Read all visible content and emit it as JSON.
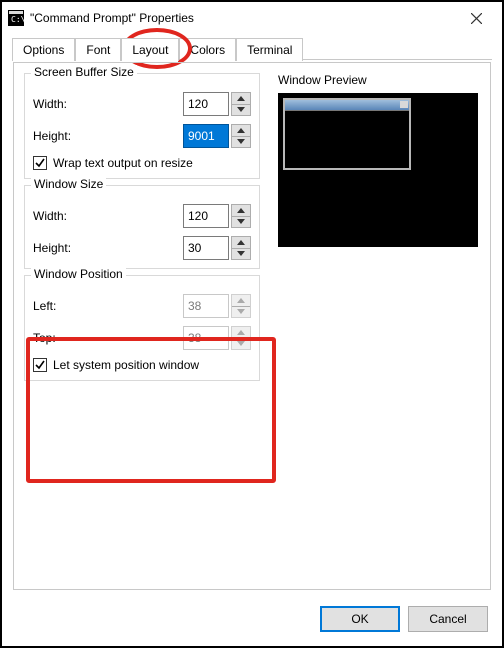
{
  "window": {
    "title": "\"Command Prompt\" Properties"
  },
  "tabs": {
    "options": "Options",
    "font": "Font",
    "layout": "Layout",
    "colors": "Colors",
    "terminal": "Terminal",
    "active": "layout"
  },
  "screen_buffer": {
    "title": "Screen Buffer Size",
    "width_label": "Width:",
    "width_value": "120",
    "height_label": "Height:",
    "height_value": "9001",
    "wrap_label": "Wrap text output on resize",
    "wrap_checked": true
  },
  "window_size": {
    "title": "Window Size",
    "width_label": "Width:",
    "width_value": "120",
    "height_label": "Height:",
    "height_value": "30"
  },
  "window_position": {
    "title": "Window Position",
    "left_label": "Left:",
    "left_value": "38",
    "top_label": "Top:",
    "top_value": "38",
    "auto_label": "Let system position window",
    "auto_checked": true
  },
  "preview": {
    "label": "Window Preview"
  },
  "buttons": {
    "ok": "OK",
    "cancel": "Cancel"
  }
}
